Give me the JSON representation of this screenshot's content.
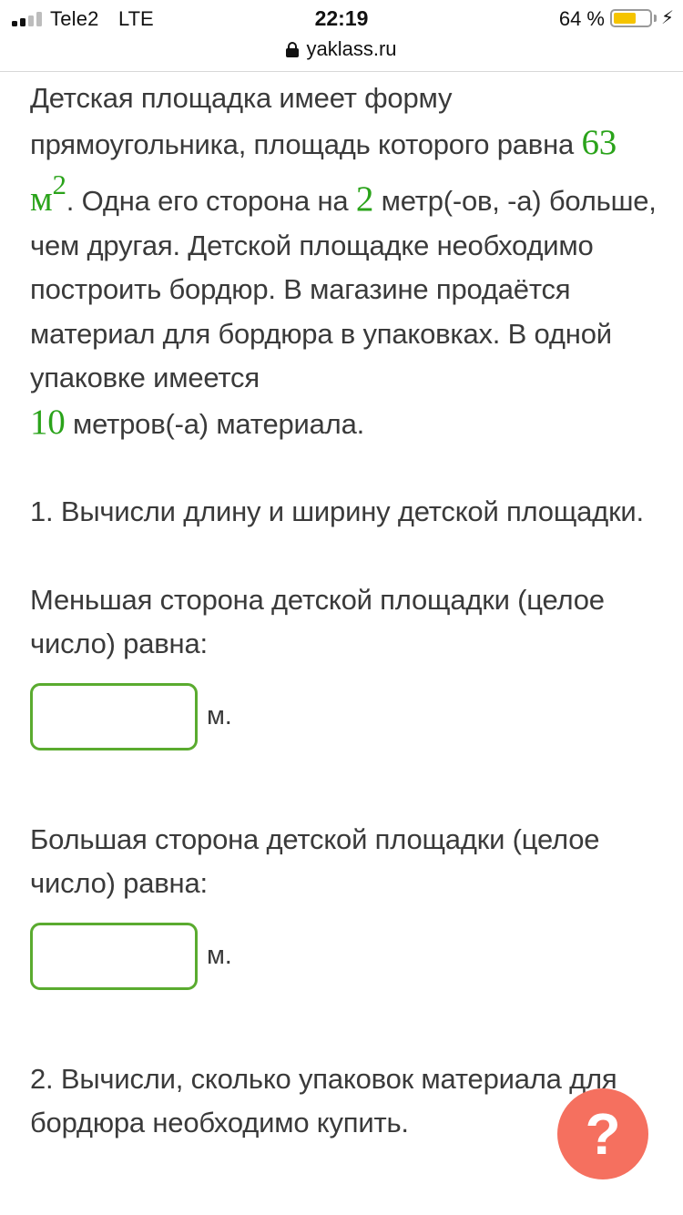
{
  "status_bar": {
    "carrier": "Tele2",
    "network": "LTE",
    "time": "22:19",
    "battery_percent": "64 %",
    "battery_level": 0.64,
    "battery_color": "#f5c400"
  },
  "url_bar": {
    "domain": "yaklass.ru"
  },
  "problem": {
    "part1": "Детская площадка имеет форму прямоугольника, площадь которого равна ",
    "area_value": "63",
    "area_unit": "м",
    "area_exponent": "2",
    "part2": ". Одна его сторона на ",
    "diff_value": "2",
    "part3": " метр(-ов, -а) больше, чем другая. Детской площадке необходимо построить бордюр. В магазине продаётся материал для бордюра в упаковках. В одной упаковке имеется ",
    "pack_value": "10",
    "part4": " метров(-а) материала."
  },
  "task1": {
    "label": "1. Вычисли длину и ширину детской площадки."
  },
  "smaller_side": {
    "label": "Меньшая сторона детской площадки (целое число) равна:",
    "value": "",
    "unit": "м."
  },
  "larger_side": {
    "label": "Большая сторона детской площадки (целое число) равна:",
    "value": "",
    "unit": "м."
  },
  "task2": {
    "label": "2. Вычисли, сколько упаковок материала для бордюра необходимо купить."
  },
  "help_button": {
    "label": "?",
    "color": "#f5705f"
  },
  "accent_color": "#2aa31a"
}
